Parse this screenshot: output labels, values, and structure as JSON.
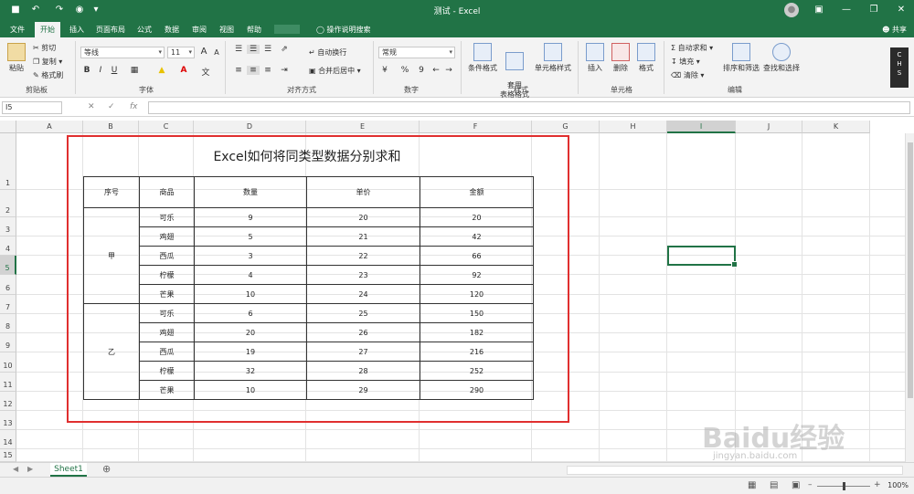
{
  "titlebar": {
    "title": "测试 - Excel"
  },
  "tabs": [
    "文件",
    "开始",
    "插入",
    "页面布局",
    "公式",
    "数据",
    "审阅",
    "视图",
    "帮助"
  ],
  "tell_me": "操作说明搜索",
  "share": "共享",
  "ribbon": {
    "clipboard": {
      "paste": "粘贴",
      "cut": "剪切",
      "copy": "复制",
      "format_painter": "格式刷",
      "label": "剪贴板"
    },
    "font": {
      "name": "等线",
      "size": "11",
      "bold": "B",
      "italic": "I",
      "underline": "U",
      "grow": "A",
      "shrink": "A",
      "label": "字体"
    },
    "alignment": {
      "wrap": "自动换行",
      "merge": "合并后居中",
      "label": "对齐方式"
    },
    "number": {
      "format": "常规",
      "percent": "%",
      "comma": "9",
      "label": "数字"
    },
    "styles": {
      "conditional": "条件格式",
      "table": "套用\n表格格式",
      "cell": "单元格样式",
      "label": "样式"
    },
    "cells": {
      "insert": "插入",
      "delete": "删除",
      "format": "格式",
      "label": "单元格"
    },
    "editing": {
      "autosum": "自动求和",
      "fill": "填充",
      "clear": "清除",
      "sort": "排序和筛选",
      "find": "查找和选择",
      "label": "编辑"
    },
    "chs": [
      "C",
      "H",
      "S"
    ]
  },
  "formula_bar": {
    "name_box": "I5",
    "fx": "fx",
    "value": ""
  },
  "columns": [
    "A",
    "B",
    "C",
    "D",
    "E",
    "F",
    "G",
    "H",
    "I",
    "J",
    "K"
  ],
  "rows": [
    "1",
    "2",
    "3",
    "4",
    "5",
    "6",
    "7",
    "8",
    "9",
    "10",
    "11",
    "12",
    "13",
    "14",
    "15"
  ],
  "selected_cell": "I5",
  "table": {
    "title": "Excel如何将同类型数据分别求和",
    "headers": [
      "序号",
      "商品",
      "数量",
      "单价",
      "金额"
    ],
    "groups": [
      {
        "name": "甲",
        "rows": [
          [
            "可乐",
            "9",
            "20",
            "20"
          ],
          [
            "鸡翅",
            "5",
            "21",
            "42"
          ],
          [
            "西瓜",
            "3",
            "22",
            "66"
          ],
          [
            "柠檬",
            "4",
            "23",
            "92"
          ],
          [
            "芒果",
            "10",
            "24",
            "120"
          ]
        ]
      },
      {
        "name": "乙",
        "rows": [
          [
            "可乐",
            "6",
            "25",
            "150"
          ],
          [
            "鸡翅",
            "20",
            "26",
            "182"
          ],
          [
            "西瓜",
            "19",
            "27",
            "216"
          ],
          [
            "柠檬",
            "32",
            "28",
            "252"
          ],
          [
            "芒果",
            "10",
            "29",
            "290"
          ]
        ]
      }
    ]
  },
  "sheet_tab": "Sheet1",
  "zoom": "100%",
  "watermark": "Baidu经验",
  "watermark_url": "jingyan.baidu.com"
}
